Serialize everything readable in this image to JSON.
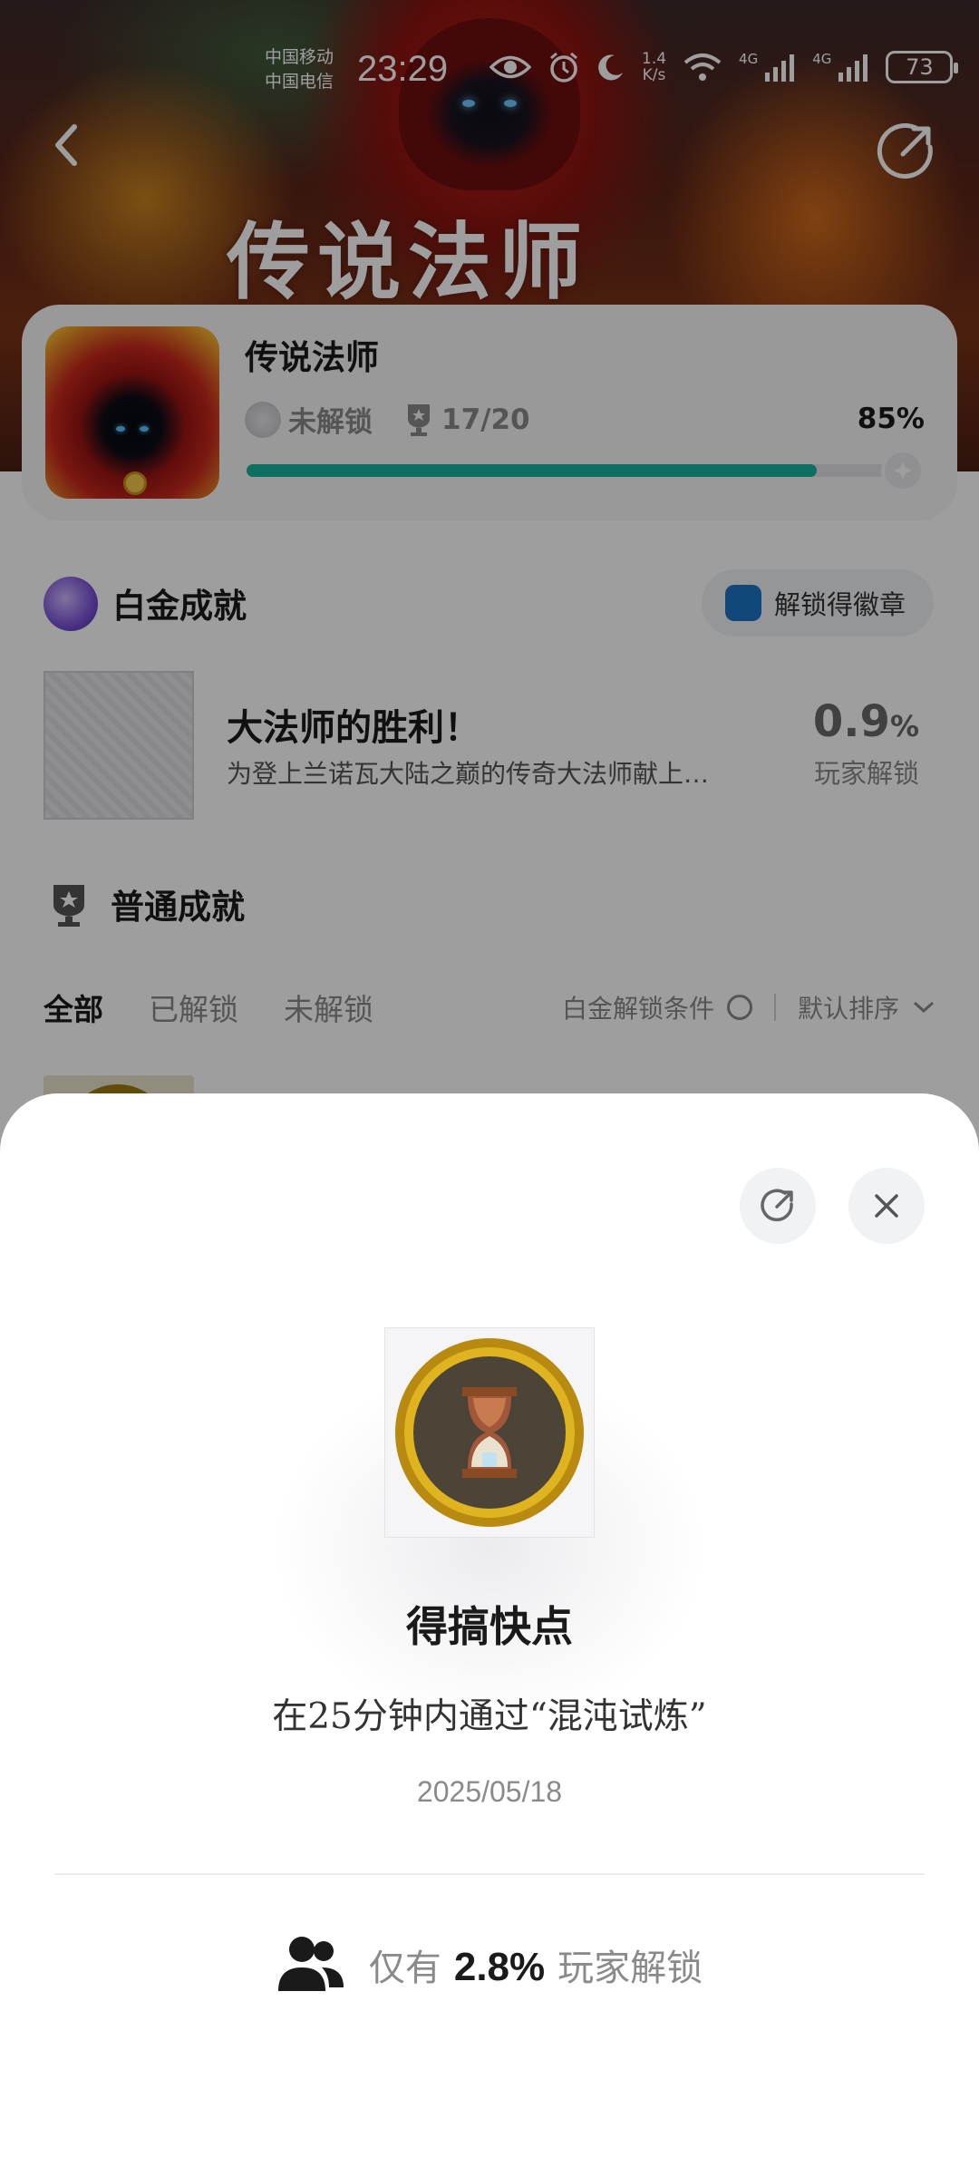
{
  "status_bar": {
    "carrier_1": "中国移动",
    "carrier_2": "中国电信",
    "time": "23:29",
    "net_speed_value": "1.4",
    "net_speed_unit": "K/s",
    "sig1_label": "4G",
    "sig2_label": "4G",
    "battery": "73"
  },
  "hero": {
    "art_title": "传说法师"
  },
  "game": {
    "name": "传说法师",
    "lock_status": "未解锁",
    "trophy_count": "17/20",
    "percent": "85%",
    "progress": 0.85
  },
  "platinum": {
    "section_title": "白金成就",
    "badge_button": "解锁得徽章",
    "item": {
      "name": "大法师的胜利！",
      "desc": "为登上兰诺瓦大陆之巅的传奇大法师献上…",
      "pct_value": "0.9",
      "pct_unit": "%",
      "pct_label": "玩家解锁"
    }
  },
  "normal": {
    "section_title": "普通成就",
    "tabs": [
      {
        "label": "全部",
        "active": true
      },
      {
        "label": "已解锁",
        "active": false
      },
      {
        "label": "未解锁",
        "active": false
      }
    ],
    "filter_label": "白金解锁条件",
    "sort_label": "默认排序"
  },
  "sheet": {
    "title": "得搞快点",
    "desc": "在25分钟内通过“混沌试炼”",
    "date": "2025/05/18",
    "stat_prefix": "仅有",
    "stat_value": "2.8%",
    "stat_suffix": "玩家解锁"
  },
  "colors": {
    "progress_fill": "#16b39c",
    "overlay": "rgba(0,0,0,0.38)",
    "medal_gold": "#c79a12"
  },
  "icons": [
    "back-icon",
    "share-icon",
    "eye-icon",
    "alarm-icon",
    "moon-icon",
    "wifi-icon",
    "signal-icon",
    "battery-icon",
    "trophy-icon",
    "close-icon",
    "users-icon",
    "chevron-down-icon",
    "hourglass-medal-icon"
  ]
}
